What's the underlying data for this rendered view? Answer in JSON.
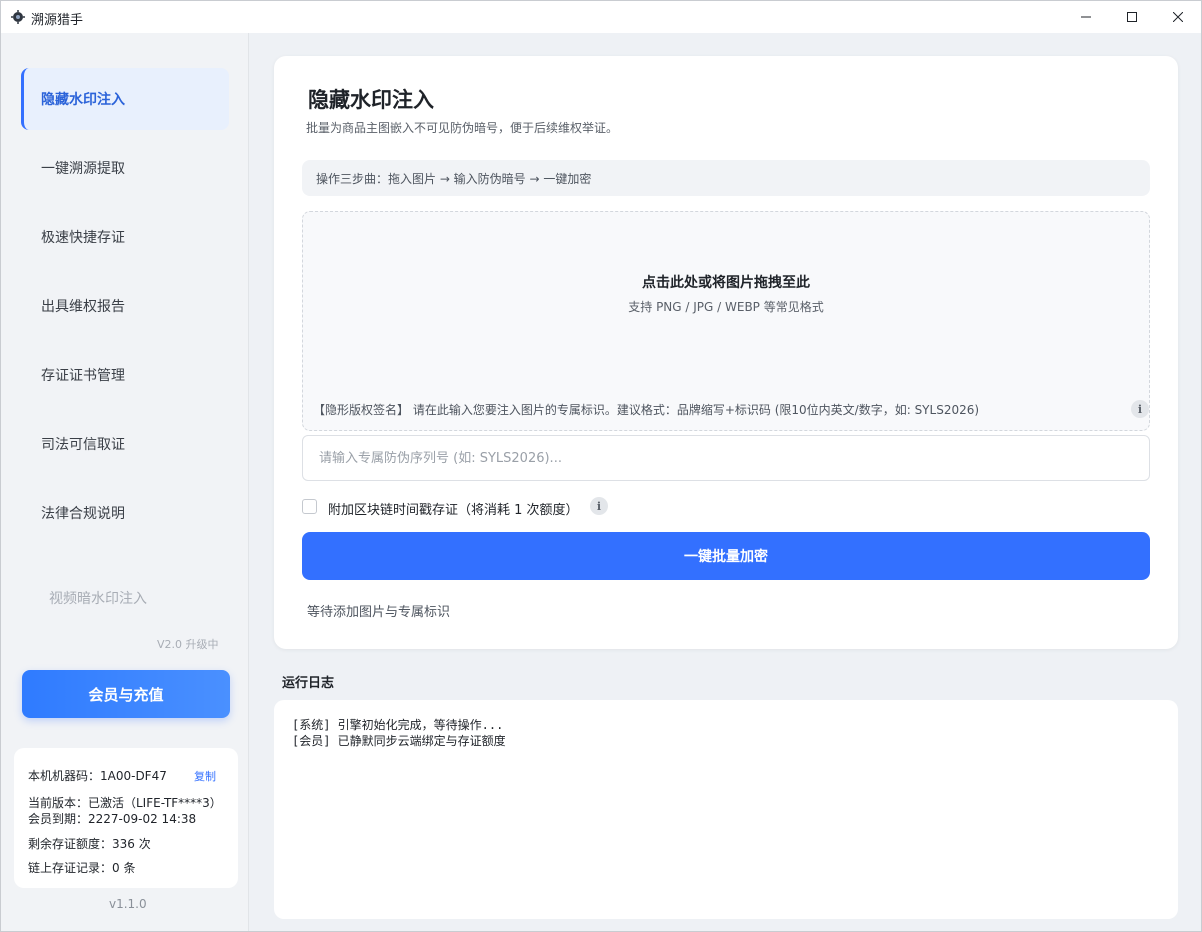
{
  "window": {
    "title": "溯源猎手",
    "controls": {
      "minimize": "minimize-icon",
      "maximize": "maximize-icon",
      "close": "close-icon"
    }
  },
  "sidebar": {
    "items": [
      {
        "label": "隐藏水印注入",
        "active": true
      },
      {
        "label": "一键溯源提取",
        "active": false
      },
      {
        "label": "极速快捷存证",
        "active": false
      },
      {
        "label": "出具维权报告",
        "active": false
      },
      {
        "label": "存证证书管理",
        "active": false
      },
      {
        "label": "司法可信取证",
        "active": false
      },
      {
        "label": "法律合规说明",
        "active": false
      }
    ],
    "disabled_item": {
      "label": "视频暗水印注入",
      "note": "V2.0 升级中"
    },
    "vip_button": "会员与充值",
    "info": {
      "machine_code": "本机机器码：1A00-DF47",
      "copy": "复制",
      "license": "当前版本：已激活（LIFE-TF****3）",
      "expiry": "会员到期：2227-09-02 14:38",
      "quota": "剩余存证额度：336 次",
      "records": "链上存证记录：0 条"
    },
    "version": "v1.1.0"
  },
  "main": {
    "title": "隐藏水印注入",
    "subtitle": "批量为商品主图嵌入不可见防伪暗号，便于后续维权举证。",
    "steps": "操作三步曲：拖入图片 → 输入防伪暗号 → 一键加密",
    "dropzone": {
      "title": "点击此处或将图片拖拽至此",
      "subtitle": "支持 PNG / JPG / WEBP 等常见格式",
      "signature_tag": "【隐形版权签名】",
      "signature_hint": "请在此输入您要注入图片的专属标识。建议格式：品牌缩写+标识码 (限10位内英文/数字，如: SYLS2026)"
    },
    "serial_input": {
      "placeholder": "请输入专属防伪序列号 (如: SYLS2026)...",
      "value": ""
    },
    "blockchain_option": {
      "label": "附加区块链时间戳存证（将消耗 1 次额度）",
      "checked": false
    },
    "encrypt_button": "一键批量加密",
    "status": "等待添加图片与专属标识"
  },
  "log": {
    "title": "运行日志",
    "lines": [
      "[系统] 引擎初始化完成，等待操作...",
      "[会员] 已静默同步云端绑定与存证额度"
    ]
  },
  "colors": {
    "accent": "#3370ff",
    "active_nav_bg": "#e8f0fd",
    "sidebar_bg": "#f1f3f6",
    "page_bg": "#eef1f5"
  }
}
